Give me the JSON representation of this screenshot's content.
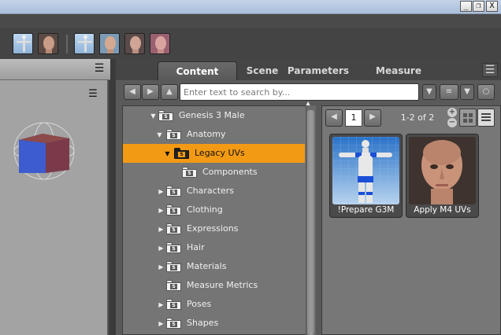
{
  "window": {
    "buttons": [
      "_",
      "❐",
      "X"
    ]
  },
  "tabs": [
    {
      "label": "Content Library",
      "active": true
    },
    {
      "label": "Scene",
      "active": false
    },
    {
      "label": "Parameters",
      "active": false
    },
    {
      "label": "Measure Metrics",
      "active": false
    }
  ],
  "search": {
    "placeholder": "Enter text to search by..."
  },
  "tree": [
    {
      "label": "Genesis 3 Male",
      "expanded": true,
      "level": 0
    },
    {
      "label": "Anatomy",
      "expanded": true,
      "level": 1
    },
    {
      "label": "Legacy UVs",
      "expanded": true,
      "level": 2,
      "selected": true
    },
    {
      "label": "Components",
      "level": 3
    },
    {
      "label": "Characters",
      "expanded": false,
      "level": 1
    },
    {
      "label": "Clothing",
      "expanded": false,
      "level": 1
    },
    {
      "label": "Expressions",
      "expanded": false,
      "level": 1
    },
    {
      "label": "Hair",
      "expanded": false,
      "level": 1
    },
    {
      "label": "Materials",
      "expanded": false,
      "level": 1
    },
    {
      "label": "Measure Metrics",
      "level": 1
    },
    {
      "label": "Poses",
      "expanded": false,
      "level": 1
    },
    {
      "label": "Shapes",
      "expanded": false,
      "level": 1
    }
  ],
  "folder_glyph": "S",
  "pagination": {
    "page": "1",
    "count": "1-2 of 2"
  },
  "items": [
    {
      "label": "!Prepare G3M"
    },
    {
      "label": "Apply M4 UVs"
    }
  ],
  "colors": {
    "selection": "#f39a15",
    "accent_blue": "#1a4fd6"
  }
}
